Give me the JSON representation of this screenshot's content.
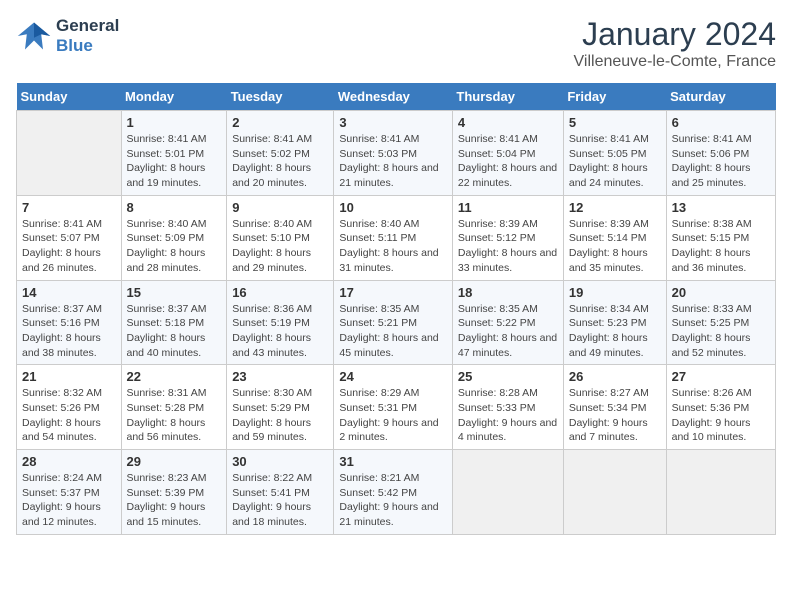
{
  "header": {
    "logo_line1": "General",
    "logo_line2": "Blue",
    "title": "January 2024",
    "subtitle": "Villeneuve-le-Comte, France"
  },
  "days_of_week": [
    "Sunday",
    "Monday",
    "Tuesday",
    "Wednesday",
    "Thursday",
    "Friday",
    "Saturday"
  ],
  "weeks": [
    [
      {
        "num": "",
        "empty": true
      },
      {
        "num": "1",
        "sunrise": "Sunrise: 8:41 AM",
        "sunset": "Sunset: 5:01 PM",
        "daylight": "Daylight: 8 hours and 19 minutes."
      },
      {
        "num": "2",
        "sunrise": "Sunrise: 8:41 AM",
        "sunset": "Sunset: 5:02 PM",
        "daylight": "Daylight: 8 hours and 20 minutes."
      },
      {
        "num": "3",
        "sunrise": "Sunrise: 8:41 AM",
        "sunset": "Sunset: 5:03 PM",
        "daylight": "Daylight: 8 hours and 21 minutes."
      },
      {
        "num": "4",
        "sunrise": "Sunrise: 8:41 AM",
        "sunset": "Sunset: 5:04 PM",
        "daylight": "Daylight: 8 hours and 22 minutes."
      },
      {
        "num": "5",
        "sunrise": "Sunrise: 8:41 AM",
        "sunset": "Sunset: 5:05 PM",
        "daylight": "Daylight: 8 hours and 24 minutes."
      },
      {
        "num": "6",
        "sunrise": "Sunrise: 8:41 AM",
        "sunset": "Sunset: 5:06 PM",
        "daylight": "Daylight: 8 hours and 25 minutes."
      }
    ],
    [
      {
        "num": "7",
        "sunrise": "Sunrise: 8:41 AM",
        "sunset": "Sunset: 5:07 PM",
        "daylight": "Daylight: 8 hours and 26 minutes."
      },
      {
        "num": "8",
        "sunrise": "Sunrise: 8:40 AM",
        "sunset": "Sunset: 5:09 PM",
        "daylight": "Daylight: 8 hours and 28 minutes."
      },
      {
        "num": "9",
        "sunrise": "Sunrise: 8:40 AM",
        "sunset": "Sunset: 5:10 PM",
        "daylight": "Daylight: 8 hours and 29 minutes."
      },
      {
        "num": "10",
        "sunrise": "Sunrise: 8:40 AM",
        "sunset": "Sunset: 5:11 PM",
        "daylight": "Daylight: 8 hours and 31 minutes."
      },
      {
        "num": "11",
        "sunrise": "Sunrise: 8:39 AM",
        "sunset": "Sunset: 5:12 PM",
        "daylight": "Daylight: 8 hours and 33 minutes."
      },
      {
        "num": "12",
        "sunrise": "Sunrise: 8:39 AM",
        "sunset": "Sunset: 5:14 PM",
        "daylight": "Daylight: 8 hours and 35 minutes."
      },
      {
        "num": "13",
        "sunrise": "Sunrise: 8:38 AM",
        "sunset": "Sunset: 5:15 PM",
        "daylight": "Daylight: 8 hours and 36 minutes."
      }
    ],
    [
      {
        "num": "14",
        "sunrise": "Sunrise: 8:37 AM",
        "sunset": "Sunset: 5:16 PM",
        "daylight": "Daylight: 8 hours and 38 minutes."
      },
      {
        "num": "15",
        "sunrise": "Sunrise: 8:37 AM",
        "sunset": "Sunset: 5:18 PM",
        "daylight": "Daylight: 8 hours and 40 minutes."
      },
      {
        "num": "16",
        "sunrise": "Sunrise: 8:36 AM",
        "sunset": "Sunset: 5:19 PM",
        "daylight": "Daylight: 8 hours and 43 minutes."
      },
      {
        "num": "17",
        "sunrise": "Sunrise: 8:35 AM",
        "sunset": "Sunset: 5:21 PM",
        "daylight": "Daylight: 8 hours and 45 minutes."
      },
      {
        "num": "18",
        "sunrise": "Sunrise: 8:35 AM",
        "sunset": "Sunset: 5:22 PM",
        "daylight": "Daylight: 8 hours and 47 minutes."
      },
      {
        "num": "19",
        "sunrise": "Sunrise: 8:34 AM",
        "sunset": "Sunset: 5:23 PM",
        "daylight": "Daylight: 8 hours and 49 minutes."
      },
      {
        "num": "20",
        "sunrise": "Sunrise: 8:33 AM",
        "sunset": "Sunset: 5:25 PM",
        "daylight": "Daylight: 8 hours and 52 minutes."
      }
    ],
    [
      {
        "num": "21",
        "sunrise": "Sunrise: 8:32 AM",
        "sunset": "Sunset: 5:26 PM",
        "daylight": "Daylight: 8 hours and 54 minutes."
      },
      {
        "num": "22",
        "sunrise": "Sunrise: 8:31 AM",
        "sunset": "Sunset: 5:28 PM",
        "daylight": "Daylight: 8 hours and 56 minutes."
      },
      {
        "num": "23",
        "sunrise": "Sunrise: 8:30 AM",
        "sunset": "Sunset: 5:29 PM",
        "daylight": "Daylight: 8 hours and 59 minutes."
      },
      {
        "num": "24",
        "sunrise": "Sunrise: 8:29 AM",
        "sunset": "Sunset: 5:31 PM",
        "daylight": "Daylight: 9 hours and 2 minutes."
      },
      {
        "num": "25",
        "sunrise": "Sunrise: 8:28 AM",
        "sunset": "Sunset: 5:33 PM",
        "daylight": "Daylight: 9 hours and 4 minutes."
      },
      {
        "num": "26",
        "sunrise": "Sunrise: 8:27 AM",
        "sunset": "Sunset: 5:34 PM",
        "daylight": "Daylight: 9 hours and 7 minutes."
      },
      {
        "num": "27",
        "sunrise": "Sunrise: 8:26 AM",
        "sunset": "Sunset: 5:36 PM",
        "daylight": "Daylight: 9 hours and 10 minutes."
      }
    ],
    [
      {
        "num": "28",
        "sunrise": "Sunrise: 8:24 AM",
        "sunset": "Sunset: 5:37 PM",
        "daylight": "Daylight: 9 hours and 12 minutes."
      },
      {
        "num": "29",
        "sunrise": "Sunrise: 8:23 AM",
        "sunset": "Sunset: 5:39 PM",
        "daylight": "Daylight: 9 hours and 15 minutes."
      },
      {
        "num": "30",
        "sunrise": "Sunrise: 8:22 AM",
        "sunset": "Sunset: 5:41 PM",
        "daylight": "Daylight: 9 hours and 18 minutes."
      },
      {
        "num": "31",
        "sunrise": "Sunrise: 8:21 AM",
        "sunset": "Sunset: 5:42 PM",
        "daylight": "Daylight: 9 hours and 21 minutes."
      },
      {
        "num": "",
        "empty": true
      },
      {
        "num": "",
        "empty": true
      },
      {
        "num": "",
        "empty": true
      }
    ]
  ]
}
